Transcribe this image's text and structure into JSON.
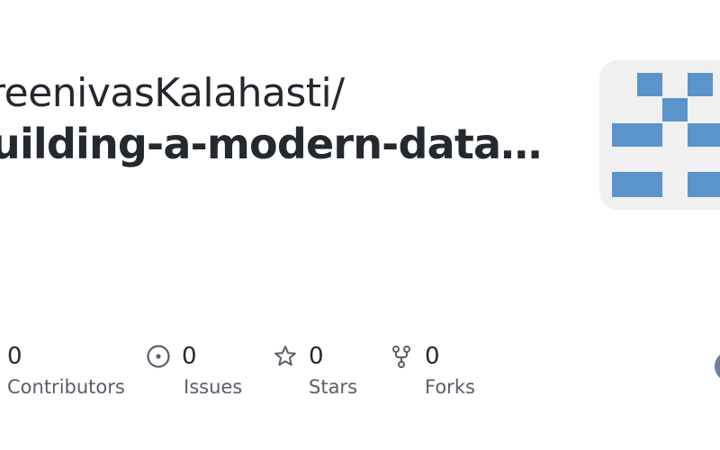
{
  "header": {
    "owner": "reenivasKalahasti/",
    "repo": "uilding-a-modern-data…"
  },
  "avatar": {
    "icon": "identicon",
    "color": "#5a94cb",
    "background": "#f0f0f0"
  },
  "stats": {
    "contributors": {
      "value": "0",
      "label": "Contributors"
    },
    "issues": {
      "value": "0",
      "label": "Issues",
      "icon": "issue-opened-icon"
    },
    "stars": {
      "value": "0",
      "label": "Stars",
      "icon": "star-icon"
    },
    "forks": {
      "value": "0",
      "label": "Forks",
      "icon": "repo-forked-icon"
    }
  },
  "colors": {
    "text": "#24292f",
    "muted": "#57606a"
  }
}
